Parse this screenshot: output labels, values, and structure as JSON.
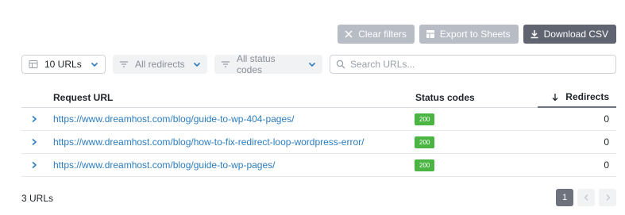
{
  "toolbar": {
    "clear_filters": "Clear filters",
    "export_sheets": "Export to Sheets",
    "download_csv": "Download CSV"
  },
  "filters": {
    "urls_count": "10 URLs",
    "redirects": "All redirects",
    "status_codes": "All status codes",
    "search_placeholder": "Search URLs..."
  },
  "table": {
    "headers": {
      "request_url": "Request URL",
      "status_codes": "Status codes",
      "redirects": "Redirects"
    },
    "rows": [
      {
        "url": "https://www.dreamhost.com/blog/guide-to-wp-404-pages/",
        "status": "200",
        "redirects": "0"
      },
      {
        "url": "https://www.dreamhost.com/blog/how-to-fix-redirect-loop-wordpress-error/",
        "status": "200",
        "redirects": "0"
      },
      {
        "url": "https://www.dreamhost.com/blog/guide-to-wp-pages/",
        "status": "200",
        "redirects": "0"
      }
    ]
  },
  "footer": {
    "count": "3 URLs",
    "current_page": "1"
  },
  "colors": {
    "link": "#2c7dbf",
    "badge_ok": "#4bb543",
    "button_primary": "#5f6470",
    "button_disabled": "#b8bcc5"
  }
}
